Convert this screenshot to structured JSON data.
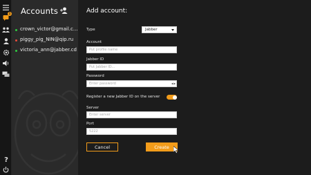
{
  "rail": {
    "icons": [
      "menu-icon",
      "chats-icon",
      "contacts-icon",
      "profile-icon",
      "settings-icon",
      "sound-icon",
      "chat-history-icon",
      "help-icon",
      "power-icon"
    ],
    "chats_badge": "1"
  },
  "accounts": {
    "title": "Accounts",
    "items": [
      {
        "name": "crown_victor@gmail.c...",
        "status_color": "#2ecc40"
      },
      {
        "name": "piggy_pig_NIN@qip.ru",
        "status_color": "#e74c3c"
      },
      {
        "name": "victoria_ann@jabber.cd",
        "status_color": "#2ecc40"
      }
    ]
  },
  "form": {
    "title": "Add account:",
    "type_label": "Type",
    "type_value": "Jabber",
    "account_label": "Account",
    "account_placeholder": "Put profile name",
    "jabber_id_label": "Jabber ID",
    "jabber_id_placeholder": "Put Jabber ID...",
    "password_label": "Password",
    "password_placeholder": "Enter password",
    "register_label": "Register a new Jabber ID on the server",
    "register_enabled": true,
    "server_label": "Server",
    "server_placeholder": "Enter server",
    "port_label": "Port",
    "port_placeholder": "5222",
    "cancel_label": "Cancel",
    "create_label": "Create"
  },
  "colors": {
    "accent": "#f39c1a",
    "panel": "#2a2a2a",
    "background": "#1c1c1c"
  }
}
